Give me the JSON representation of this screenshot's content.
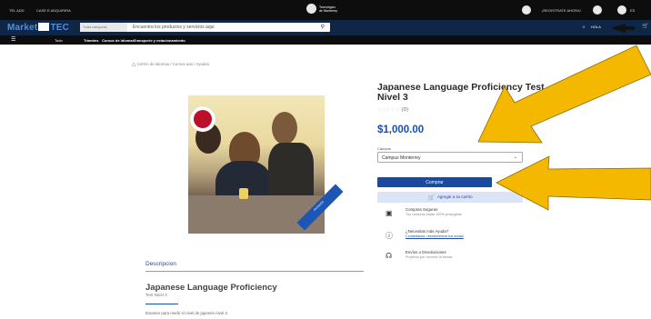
{
  "topbar": {
    "left1": "TEL ADD",
    "left2": "CASE E ADQUIRIRA",
    "logo_line1": "Tecnológico",
    "logo_line2": "de Monterrey",
    "cta": "¡REGISTRATE AHORA!",
    "lang": "ES"
  },
  "navbar": {
    "brand_left": "Market",
    "brand_right": "TEC",
    "search_category": "Todas categorías",
    "search_placeholder": "Encuentra los productos y servicios aqui",
    "user_greeting": "HOLA"
  },
  "menu": {
    "todo": "Todo",
    "item1": "Trámites",
    "item2": "Cursos de Idiomas",
    "item3": "Transporte y estacionamiento"
  },
  "breadcrumb": "Centro de idiomas / Cursos aas / Ayudas",
  "product": {
    "title": "Japanese Language Proficiency Test Nivel 3",
    "stars": "☆☆☆☆☆",
    "rating_count": "(0)",
    "side_note": "Co",
    "price": "$1,000.00",
    "campus_label": "Campus",
    "campus_value": "Campus Monterrey",
    "buy_label": "Comprar",
    "cart_label": "Agregar a su carrito",
    "image_badge": "FRANCÉS"
  },
  "features": [
    {
      "icon": "credit-card-icon",
      "title": "Compras Seguras",
      "sub": "Tus compras están 100% protegidas"
    },
    {
      "icon": "help-circle-icon",
      "title": "¿Necesitas más Ayuda?",
      "sub": "Contáctanos, resolveremos tus dudas"
    },
    {
      "icon": "headset-icon",
      "title": "Envíos o Devoluciones",
      "sub": "Proyecto por recorrer la tienda"
    }
  ],
  "description": {
    "heading": "Descripcion",
    "title": "Japanese Language Proficiency",
    "sub": "Test Nivel 3",
    "text": "Examen para medir el nivel de japonés nivel 3."
  },
  "colors": {
    "topbar": "#0d0d0d",
    "navbar": "#102646",
    "accent": "#1b4fa5",
    "arrow": "#f5b800"
  }
}
